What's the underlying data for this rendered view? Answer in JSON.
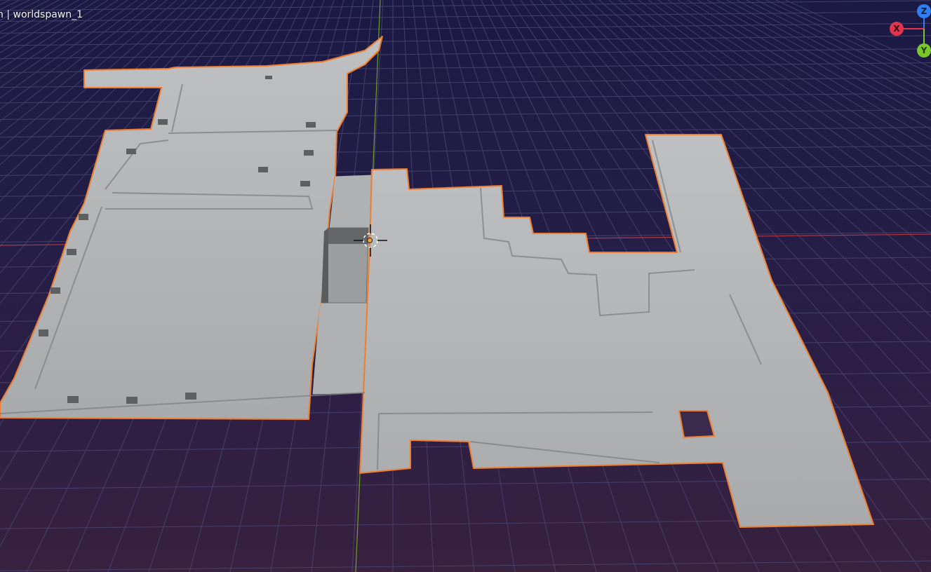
{
  "viewport": {
    "overlay_text": "n | worldspawn_1",
    "background_color": "#1c1a40",
    "grid_color": "#4a4670",
    "mesh_color": "#b3b4b6",
    "selection_outline_color": "#f07d2d"
  },
  "gizmo": {
    "z_label": "Z",
    "x_label": "X",
    "y_label": "Y",
    "z_color": "#2f7ff0",
    "x_color": "#e0344f",
    "y_color": "#7bc62c"
  },
  "icons": {
    "cursor": "3d-cursor-icon",
    "origin": "object-origin-icon"
  }
}
